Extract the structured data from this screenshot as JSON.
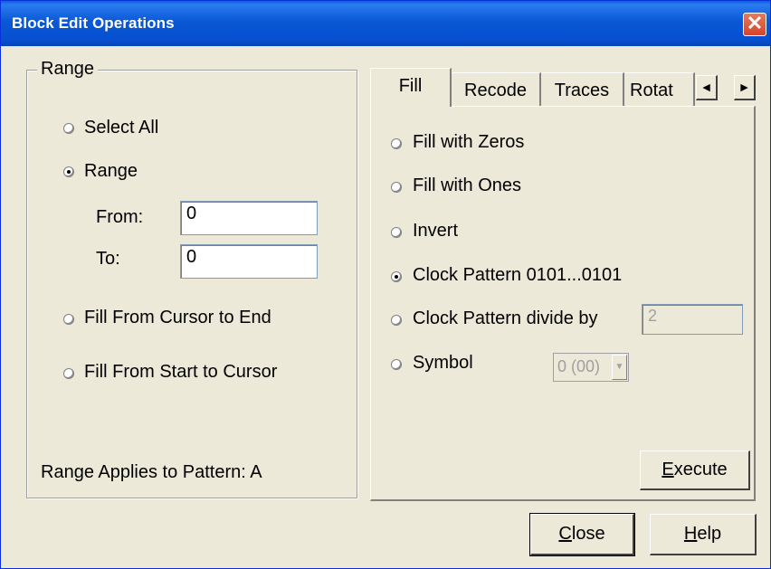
{
  "window": {
    "title": "Block Edit Operations",
    "close_glyph": "✕"
  },
  "range_group": {
    "title": "Range",
    "options": [
      {
        "label": "Select All",
        "checked": false
      },
      {
        "label": "Range",
        "checked": true
      },
      {
        "label": "Fill From Cursor to End",
        "checked": false
      },
      {
        "label": "Fill From Start to Cursor",
        "checked": false
      }
    ],
    "from_label": "From:",
    "from_value": "0",
    "to_label": "To:",
    "to_value": "0",
    "applies_text": "Range Applies to Pattern: A"
  },
  "tabs": [
    {
      "label": "Fill",
      "active": true
    },
    {
      "label": "Recode",
      "active": false
    },
    {
      "label": "Traces",
      "active": false
    },
    {
      "label": "Rotat",
      "active": false
    }
  ],
  "tab_scroll": {
    "left_glyph": "◄",
    "right_glyph": "►"
  },
  "fill_tab": {
    "options": [
      {
        "label": "Fill with Zeros",
        "checked": false
      },
      {
        "label": "Fill with Ones",
        "checked": false
      },
      {
        "label": "Invert",
        "checked": false
      },
      {
        "label": "Clock Pattern 0101...0101",
        "checked": true
      },
      {
        "label": "Clock Pattern divide by",
        "checked": false
      },
      {
        "label": "Symbol",
        "checked": false
      }
    ],
    "divide_value": "2",
    "symbol_value": "0 (00)",
    "execute_label": "Execute"
  },
  "footer": {
    "close_label": "Close",
    "help_label": "Help"
  },
  "colors": {
    "titlebar": "#0a58d6",
    "face": "#ece9d8",
    "close_button": "#d6432a"
  },
  "icons": {
    "close": "close-icon",
    "scroll_left": "arrow-left-icon",
    "scroll_right": "arrow-right-icon",
    "dropdown": "chevron-down-icon"
  }
}
